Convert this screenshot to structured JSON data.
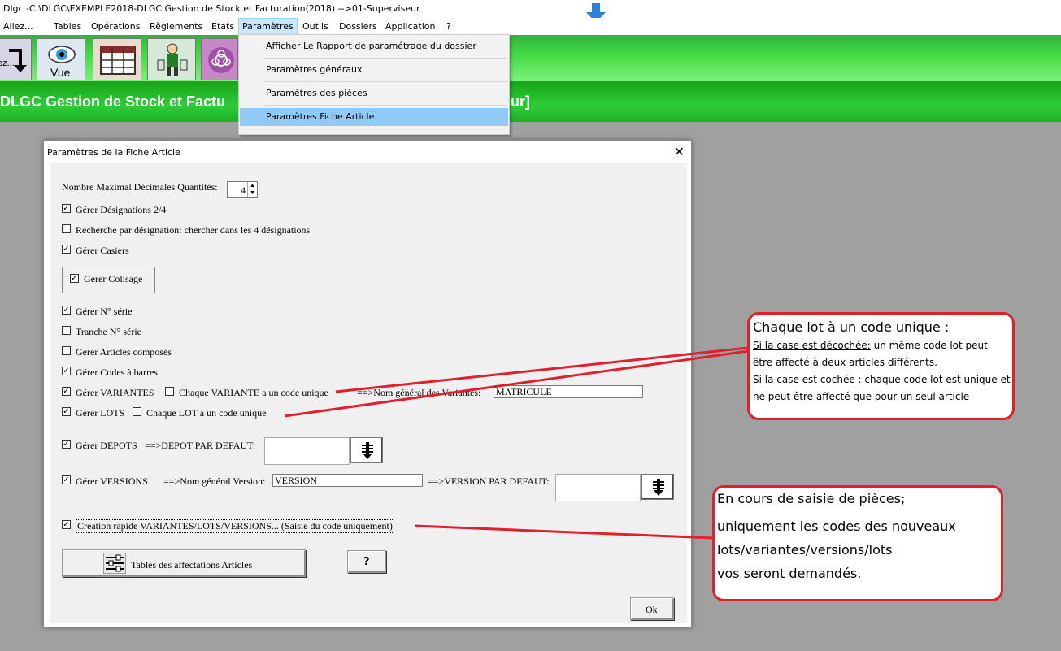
{
  "window": {
    "title": "Dlgc -C:\\DLGC\\EXEMPLE2018-DLGC Gestion de Stock et Facturation(2018) -->01-Superviseur"
  },
  "menubar": {
    "items": [
      "Allez...",
      "Tables",
      "Opérations",
      "Règlements",
      "Etats",
      "Paramètres",
      "Outils",
      "Dossiers",
      "Application",
      "?"
    ]
  },
  "toolbar": {
    "btn0": "ez...",
    "btn1": "Vue"
  },
  "banner": {
    "left": "DLGC Gestion de Stock et Factu",
    "right": "ur]"
  },
  "dropdown": {
    "items": [
      "Afficher Le Rapport de paramétrage du dossier",
      "Paramètres généraux",
      "Paramètres des pièces",
      "Paramètres Fiche Article"
    ]
  },
  "dialog": {
    "title": "Paramètres de la Fiche Article",
    "close": "✕",
    "decimals_label": "Nombre Maximal Décimales Quantités:",
    "decimals_value": "4",
    "options": {
      "designations": "Gérer Désignations 2/4",
      "recherche": "Recherche par désignation: chercher dans les 4 désignations",
      "casiers": "Gérer Casiers",
      "colisage": "Gérer Colisage",
      "serie": "Gérer N° série",
      "tranche": "Tranche N° série",
      "composes": "Gérer Articles composés",
      "barres": "Gérer Codes à barres",
      "variantes": "Gérer VARIANTES",
      "variante_unique": "Chaque VARIANTE a un code unique",
      "variantes_nom_label": "==>Nom général des Variantes:",
      "variantes_nom_value": "MATRICULE",
      "lots": "Gérer LOTS",
      "lot_unique": "Chaque LOT a un code unique",
      "depots": "Gérer DEPOTS",
      "depot_defaut": "==>DEPOT PAR DEFAUT:",
      "versions": "Gérer VERSIONS",
      "version_nom_label": "==>Nom général Version:",
      "version_nom_value": "VERSION",
      "version_defaut": "==>VERSION PAR DEFAUT:",
      "creation_rapide": "Création rapide VARIANTES/LOTS/VERSIONS... (Saisie du code uniquement)"
    },
    "tables_button": "Tables des affectations Articles",
    "help_button": "?",
    "ok_button": "Ok"
  },
  "callout1": {
    "title": "Chaque lot à un code unique :",
    "l1_u": "Si la case est décochée:",
    "l1_rest": " un même code lot peut",
    "l2": "être affecté à deux  articles différents.",
    "l3_u": "Si la case est cochée :",
    "l3_rest": " chaque code lot est unique et",
    "l4": "ne peut être affecté que pour un seul article"
  },
  "callout2": {
    "lines": [
      "En cours de saisie de pièces;",
      "uniquement les codes des nouveaux",
      "lots/variantes/versions/lots",
      "vos seront demandés."
    ]
  },
  "colors": {
    "annotation": "#e0202c",
    "selection": "#91c9f7",
    "banner_green": "#2ecc38"
  }
}
